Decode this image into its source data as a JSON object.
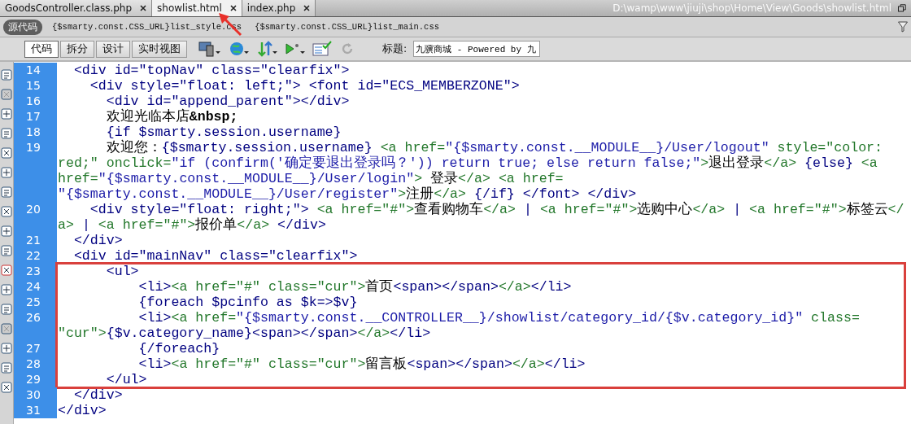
{
  "tabs": [
    {
      "label": "GoodsController.class.php",
      "selected": false
    },
    {
      "label": "showlist.html",
      "selected": true
    },
    {
      "label": "index.php",
      "selected": false
    }
  ],
  "file_path": "D:\\wamp\\www\\jiuji\\shop\\Home\\View\\Goods\\showlist.html",
  "source_button": {
    "label": "源代码",
    "selected": true
  },
  "related_files": [
    "{$smarty.const.CSS_URL}list_style.css",
    "{$smarty.const.CSS_URL}list_main.css"
  ],
  "view_buttons": [
    {
      "label": "代码",
      "selected": true
    },
    {
      "label": "拆分",
      "selected": false
    },
    {
      "label": "设计",
      "selected": false
    },
    {
      "label": "实时视图",
      "selected": false
    }
  ],
  "title_field": {
    "label": "标题:",
    "value": "九骥商城 - Powered by 九"
  },
  "code_blocks": [
    {
      "highlighted": false,
      "lines": [
        {
          "number": "14",
          "rows": [
            {
              "segments": [
                {
                  "kind": "tag",
                  "text": "  <div id=\"topNav\" class=\"clearfix\">"
                }
              ]
            }
          ]
        },
        {
          "number": "15",
          "rows": [
            {
              "segments": [
                {
                  "kind": "tag",
                  "text": "    <div style=\"float: left;\"> <font id=\"ECS_MEMBERZONE\">"
                }
              ]
            }
          ]
        },
        {
          "number": "16",
          "rows": [
            {
              "segments": [
                {
                  "kind": "tag",
                  "text": "      <div id=\"append_parent\"></div>"
                }
              ]
            }
          ]
        },
        {
          "number": "17",
          "rows": [
            {
              "segments": [
                {
                  "kind": "text",
                  "text": "      欢迎光临本店"
                },
                {
                  "kind": "entity",
                  "text": "&nbsp;"
                }
              ]
            }
          ]
        },
        {
          "number": "18",
          "rows": [
            {
              "segments": [
                {
                  "kind": "tag",
                  "text": "      {if $smarty.session.username}"
                }
              ]
            }
          ]
        },
        {
          "number": "19",
          "rows": [
            {
              "segments": [
                {
                  "kind": "text",
                  "text": "      欢迎您："
                },
                {
                  "kind": "tag",
                  "text": "{$smarty.session.username} "
                },
                {
                  "kind": "anchor",
                  "text": "<a href="
                },
                {
                  "kind": "value",
                  "text": "\"{$smarty.const.__MODULE__}/User/logout\""
                },
                {
                  "kind": "anchor",
                  "text": " style=\"color:"
                }
              ]
            },
            {
              "segments": [
                {
                  "kind": "anchor",
                  "text": "red;\" onclick="
                },
                {
                  "kind": "value",
                  "text": "\"if (confirm('确定要退出登录吗？')) return true; else return false;\""
                },
                {
                  "kind": "anchor",
                  "text": ">"
                },
                {
                  "kind": "text",
                  "text": "退出登录"
                },
                {
                  "kind": "anchor",
                  "text": "</a>"
                },
                {
                  "kind": "tag",
                  "text": " {else} "
                },
                {
                  "kind": "anchor",
                  "text": "<a"
                }
              ]
            },
            {
              "segments": [
                {
                  "kind": "anchor",
                  "text": "href="
                },
                {
                  "kind": "value",
                  "text": "\"{$smarty.const.__MODULE__}/User/login\""
                },
                {
                  "kind": "anchor",
                  "text": ">"
                },
                {
                  "kind": "text",
                  "text": " 登录"
                },
                {
                  "kind": "anchor",
                  "text": "</a> <a href="
                }
              ]
            },
            {
              "segments": [
                {
                  "kind": "value",
                  "text": "\"{$smarty.const.__MODULE__}/User/register\""
                },
                {
                  "kind": "anchor",
                  "text": ">"
                },
                {
                  "kind": "text",
                  "text": "注册"
                },
                {
                  "kind": "anchor",
                  "text": "</a>"
                },
                {
                  "kind": "tag",
                  "text": " {/if} </font> </div>"
                }
              ]
            }
          ]
        },
        {
          "number": "20",
          "rows": [
            {
              "segments": [
                {
                  "kind": "tag",
                  "text": "    <div style=\"float: right;\"> "
                },
                {
                  "kind": "anchor",
                  "text": "<a href=\"#\">"
                },
                {
                  "kind": "text",
                  "text": "查看购物车"
                },
                {
                  "kind": "anchor",
                  "text": "</a>"
                },
                {
                  "kind": "tag",
                  "text": " | "
                },
                {
                  "kind": "anchor",
                  "text": "<a href=\"#\">"
                },
                {
                  "kind": "text",
                  "text": "选购中心"
                },
                {
                  "kind": "anchor",
                  "text": "</a>"
                },
                {
                  "kind": "tag",
                  "text": " | "
                },
                {
                  "kind": "anchor",
                  "text": "<a href=\"#\">"
                },
                {
                  "kind": "text",
                  "text": "标签云"
                },
                {
                  "kind": "anchor",
                  "text": "</"
                }
              ]
            },
            {
              "segments": [
                {
                  "kind": "anchor",
                  "text": "a>"
                },
                {
                  "kind": "tag",
                  "text": " | "
                },
                {
                  "kind": "anchor",
                  "text": "<a href=\"#\">"
                },
                {
                  "kind": "text",
                  "text": "报价单"
                },
                {
                  "kind": "anchor",
                  "text": "</a>"
                },
                {
                  "kind": "tag",
                  "text": " </div>"
                }
              ]
            }
          ]
        },
        {
          "number": "21",
          "rows": [
            {
              "segments": [
                {
                  "kind": "tag",
                  "text": "  </div>"
                }
              ]
            }
          ]
        },
        {
          "number": "22",
          "rows": [
            {
              "segments": [
                {
                  "kind": "tag",
                  "text": "  <div id=\"mainNav\" class=\"clearfix\">"
                }
              ]
            }
          ]
        }
      ]
    },
    {
      "highlighted": true,
      "lines": [
        {
          "number": "23",
          "rows": [
            {
              "segments": [
                {
                  "kind": "tag",
                  "text": "      <ul>"
                }
              ]
            }
          ]
        },
        {
          "number": "24",
          "rows": [
            {
              "segments": [
                {
                  "kind": "tag",
                  "text": "          <li>"
                },
                {
                  "kind": "anchor",
                  "text": "<a href=\"#\" class=\"cur\">"
                },
                {
                  "kind": "text",
                  "text": "首页"
                },
                {
                  "kind": "tag",
                  "text": "<span></span>"
                },
                {
                  "kind": "anchor",
                  "text": "</a>"
                },
                {
                  "kind": "tag",
                  "text": "</li>"
                }
              ]
            }
          ]
        },
        {
          "number": "25",
          "rows": [
            {
              "segments": [
                {
                  "kind": "tag",
                  "text": "          {foreach $pcinfo as $k=>$v}"
                }
              ]
            }
          ]
        },
        {
          "number": "26",
          "rows": [
            {
              "segments": [
                {
                  "kind": "tag",
                  "text": "          <li>"
                },
                {
                  "kind": "anchor",
                  "text": "<a href="
                },
                {
                  "kind": "value",
                  "text": "\"{$smarty.const.__CONTROLLER__}/showlist/category_id/{$v.category_id}\""
                },
                {
                  "kind": "anchor",
                  "text": " class="
                }
              ]
            },
            {
              "segments": [
                {
                  "kind": "anchor",
                  "text": "\"cur\">"
                },
                {
                  "kind": "tag",
                  "text": "{$v.category_name}<span></span>"
                },
                {
                  "kind": "anchor",
                  "text": "</a>"
                },
                {
                  "kind": "tag",
                  "text": "</li>"
                }
              ]
            }
          ]
        },
        {
          "number": "27",
          "rows": [
            {
              "segments": [
                {
                  "kind": "tag",
                  "text": "          {/foreach}"
                }
              ]
            }
          ]
        },
        {
          "number": "28",
          "rows": [
            {
              "segments": [
                {
                  "kind": "tag",
                  "text": "          <li>"
                },
                {
                  "kind": "anchor",
                  "text": "<a href=\"#\" class=\"cur\">"
                },
                {
                  "kind": "text",
                  "text": "留言板"
                },
                {
                  "kind": "tag",
                  "text": "<span></span>"
                },
                {
                  "kind": "anchor",
                  "text": "</a>"
                },
                {
                  "kind": "tag",
                  "text": "</li>"
                }
              ]
            }
          ]
        },
        {
          "number": "29",
          "rows": [
            {
              "segments": [
                {
                  "kind": "tag",
                  "text": "      </ul>"
                }
              ]
            }
          ]
        }
      ]
    },
    {
      "highlighted": false,
      "lines": [
        {
          "number": "30",
          "rows": [
            {
              "segments": [
                {
                  "kind": "tag",
                  "text": "  </div>"
                }
              ]
            }
          ]
        },
        {
          "number": "31",
          "rows": [
            {
              "segments": [
                {
                  "kind": "tag",
                  "text": "</div>"
                }
              ]
            }
          ]
        }
      ]
    }
  ]
}
